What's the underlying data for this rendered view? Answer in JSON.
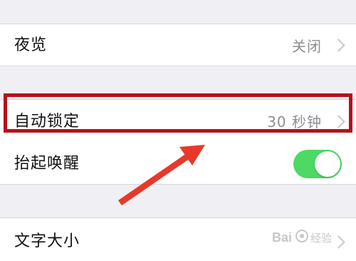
{
  "settings": {
    "night_shift": {
      "label": "夜览",
      "value": "关闭"
    },
    "auto_lock": {
      "label": "自动锁定",
      "value": "30 秒钟"
    },
    "raise_to_wake": {
      "label": "抬起唤醒",
      "enabled": true
    },
    "text_size": {
      "label": "文字大小"
    }
  },
  "annotation": {
    "highlight_color": "#b5101a",
    "arrow_color": "#e8382a"
  },
  "watermark": {
    "text": "Bai 经验"
  },
  "colors": {
    "background": "#efeff4",
    "row_background": "#ffffff",
    "toggle_on": "#4cd964",
    "secondary_text": "#8e8e93"
  }
}
